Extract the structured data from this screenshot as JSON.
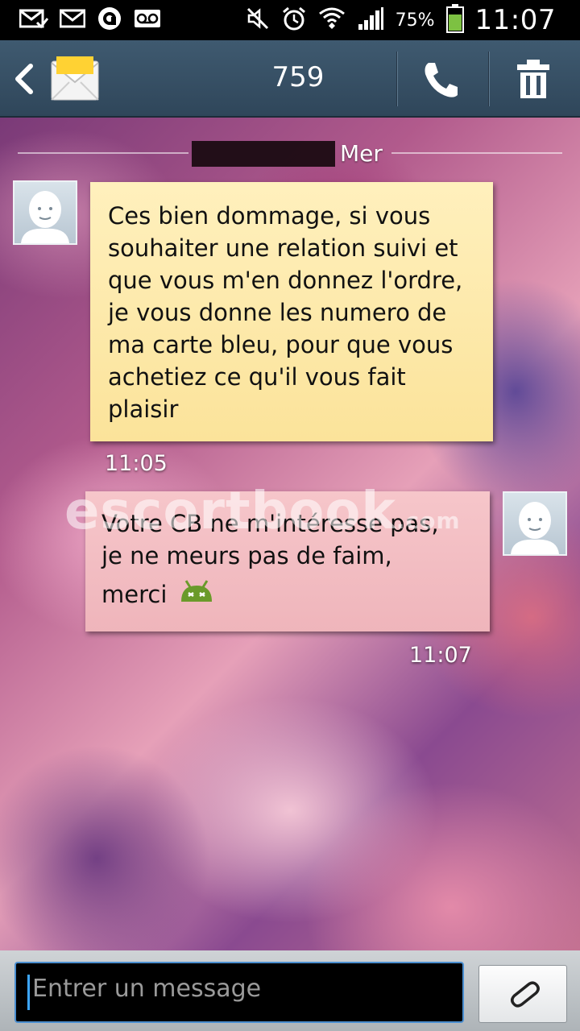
{
  "status_bar": {
    "icons": [
      "mail-check-icon",
      "mail-icon",
      "app-notification-icon",
      "voicemail-icon",
      "mute-icon",
      "alarm-icon",
      "wifi-icon",
      "signal-icon",
      "battery-icon"
    ],
    "battery_percent": "75%",
    "time": "11:07",
    "battery_level": 0.75,
    "battery_color": "#7dc142"
  },
  "header": {
    "back_icon": "chevron-left-icon",
    "app_icon": "envelope-icon",
    "title": "759",
    "call_icon": "phone-icon",
    "delete_icon": "trash-icon",
    "color": "#3a5268"
  },
  "conversation": {
    "date_label": "Mer",
    "messages": [
      {
        "direction": "incoming",
        "lines": [
          "Ces bien dommage, si vous",
          "souhaiter une relation suivi et",
          "que vous m'en donnez l'ordre,",
          "je vous donne les numero de",
          "ma carte bleu, pour que vous",
          "achetiez ce qu'il vous fait",
          "plaisir"
        ],
        "time": "11:05",
        "bubble_color": "#fdeaaa"
      },
      {
        "direction": "outgoing",
        "lines": [
          "Votre CB ne m'intéresse pas,",
          "je ne meurs pas de faim,",
          "merci"
        ],
        "emoji": "android-icon",
        "time": "11:07",
        "bubble_color": "#f3bec3"
      }
    ],
    "watermark": {
      "main": "escortbook",
      "suffix": ".com"
    }
  },
  "composer": {
    "placeholder": "Entrer un message",
    "attach_icon": "paperclip-icon"
  }
}
